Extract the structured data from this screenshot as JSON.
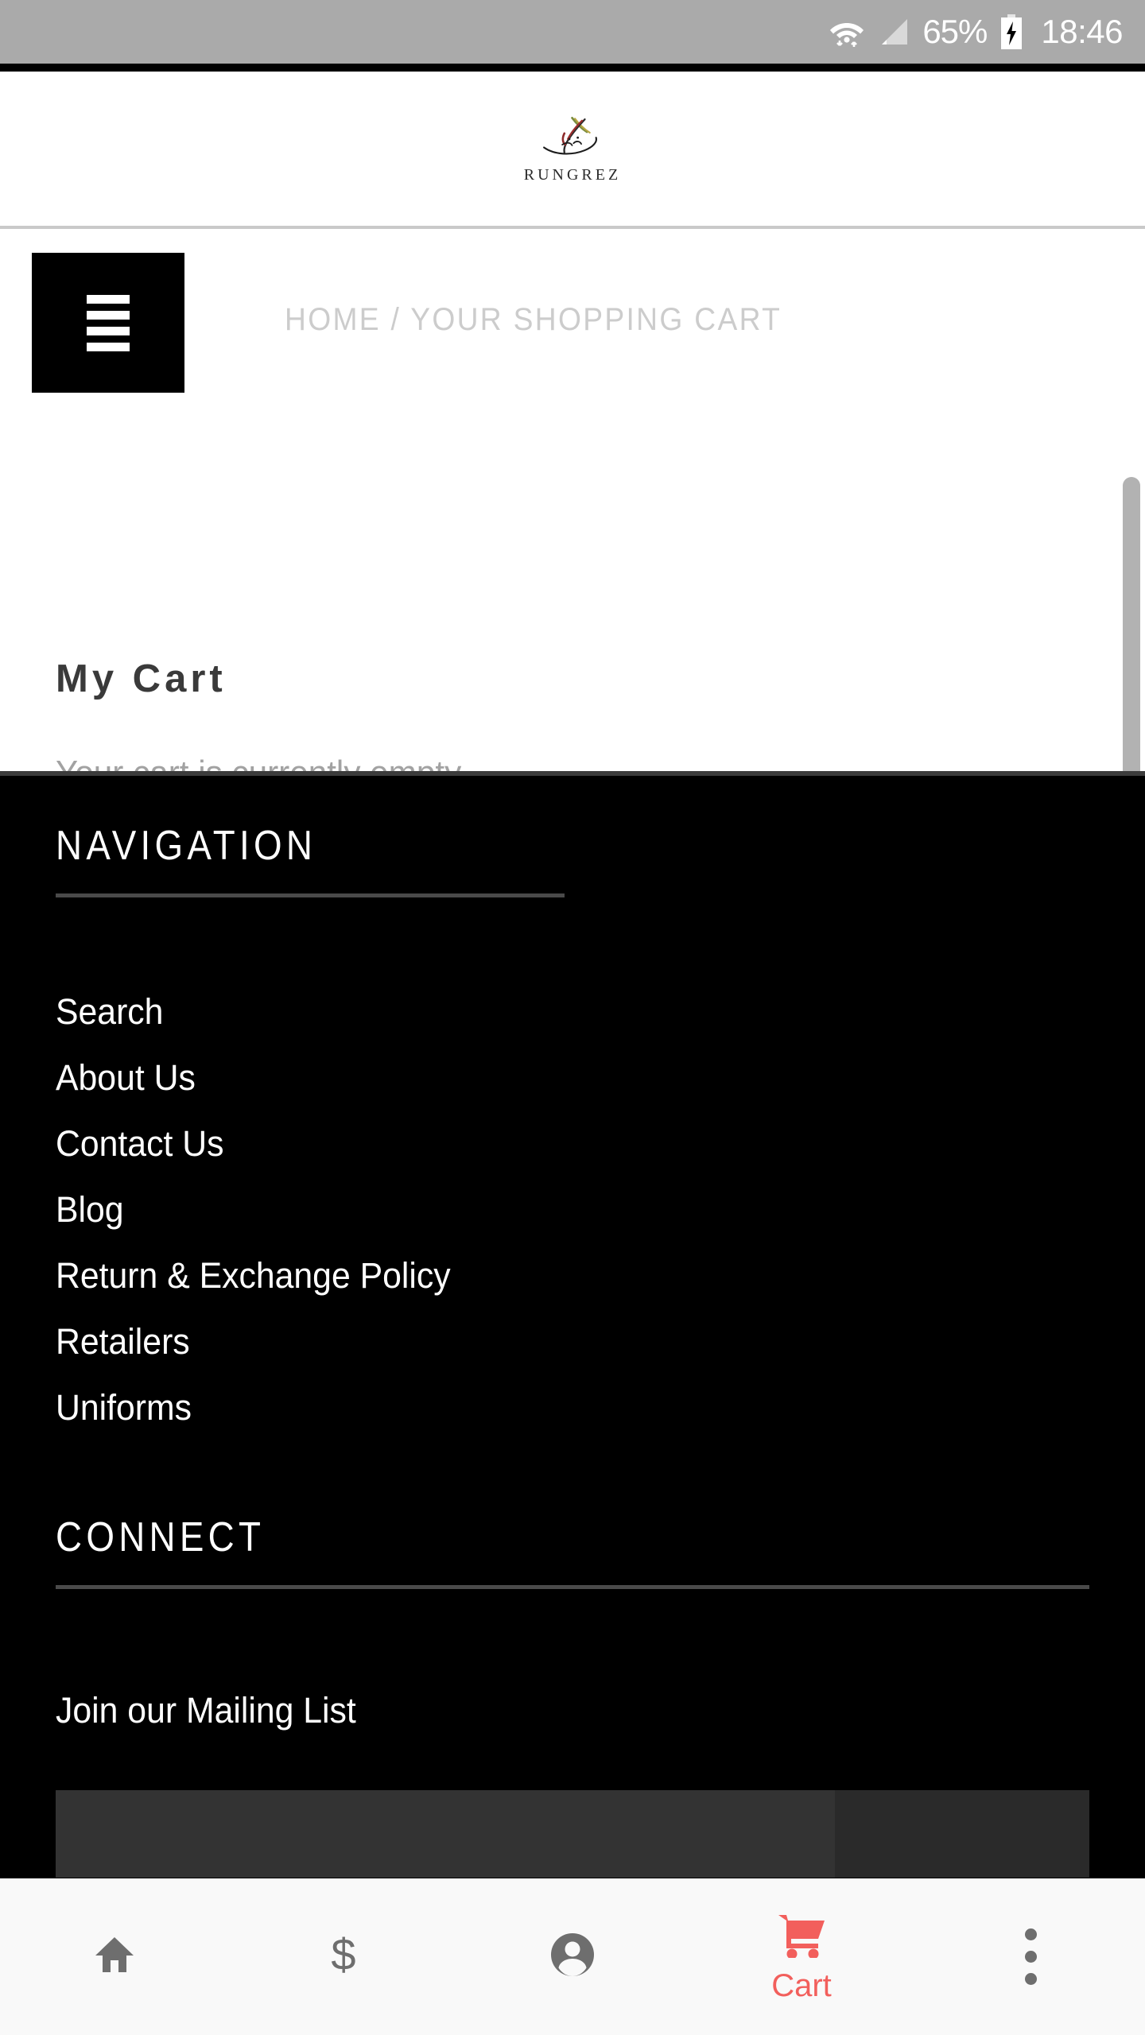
{
  "status_bar": {
    "wifi_icon": "wifi-icon",
    "signal_icon": "cellular-signal-icon",
    "battery_percent": "65%",
    "battery_icon": "battery-charging-icon",
    "time": "18:46",
    "background_color": "#aaaaaa",
    "text_color": "#ffffff"
  },
  "header": {
    "logo_wordmark": "RUNGREZ",
    "logo_icon": "rungrez-calligraphy-logo"
  },
  "page": {
    "menu_button_icon": "hamburger-menu-icon",
    "breadcrumb": "HOME / YOUR SHOPPING CART",
    "breadcrumb_home": "HOME",
    "breadcrumb_separator": "/",
    "breadcrumb_current": "YOUR SHOPPING CART",
    "title": "My Cart",
    "empty_message": "Your cart is currently empty.",
    "breadcrumb_color": "#cccccc",
    "title_color": "#3a3a3a",
    "empty_color": "#a2a2a2"
  },
  "footer": {
    "navigation_heading": "NAVIGATION",
    "nav_links": [
      {
        "label": "Search"
      },
      {
        "label": "About Us"
      },
      {
        "label": "Contact Us"
      },
      {
        "label": "Blog"
      },
      {
        "label": "Return & Exchange Policy"
      },
      {
        "label": "Retailers"
      },
      {
        "label": "Uniforms"
      }
    ],
    "connect_heading": "CONNECT",
    "mailing_list_label": "Join our Mailing List",
    "email_placeholder": "",
    "email_value": "",
    "subscribe_label": "",
    "background_color": "#000000",
    "rule_color": "#4a4a4a"
  },
  "bottom_nav": {
    "items": [
      {
        "icon": "home-icon",
        "label": "",
        "active": false
      },
      {
        "icon": "dollar-sign-icon",
        "label": "",
        "active": false
      },
      {
        "icon": "account-circle-icon",
        "label": "",
        "active": false
      },
      {
        "icon": "shopping-cart-icon",
        "label": "Cart",
        "active": true
      },
      {
        "icon": "more-vertical-icon",
        "label": "",
        "active": false
      }
    ],
    "active_color": "#f25f5c",
    "inactive_color": "#6e6e6e",
    "background_color": "#f9f9f9"
  }
}
